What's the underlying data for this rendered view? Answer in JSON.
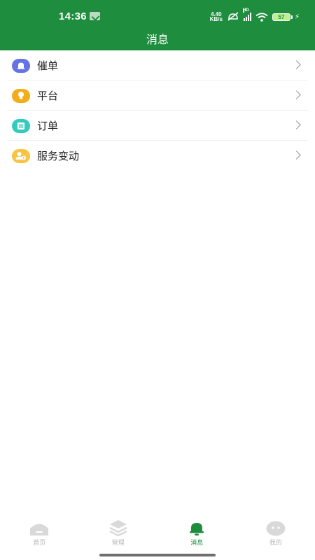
{
  "status_bar": {
    "time": "14:36",
    "net_speed_value": "4.40",
    "net_speed_unit": "KB/s",
    "hd": "HD",
    "battery": "57"
  },
  "header": {
    "title": "消息"
  },
  "list": {
    "items": [
      {
        "label": "催单",
        "icon": "bell-icon",
        "color": "#6674e3"
      },
      {
        "label": "平台",
        "icon": "lightbulb-icon",
        "color": "#f3ad1c"
      },
      {
        "label": "订单",
        "icon": "list-icon",
        "color": "#34cbbf"
      },
      {
        "label": "服务变动",
        "icon": "user-gear-icon",
        "color": "#f9c443"
      }
    ]
  },
  "tabbar": {
    "items": [
      {
        "label": "首页",
        "icon": "home-icon"
      },
      {
        "label": "管理",
        "icon": "layers-icon"
      },
      {
        "label": "消息",
        "icon": "bell-icon",
        "active": true
      },
      {
        "label": "我的",
        "icon": "chat-face-icon"
      }
    ]
  },
  "colors": {
    "primary": "#1e8e3e",
    "inactive_tab": "#b8b8b8",
    "text": "#222222"
  }
}
